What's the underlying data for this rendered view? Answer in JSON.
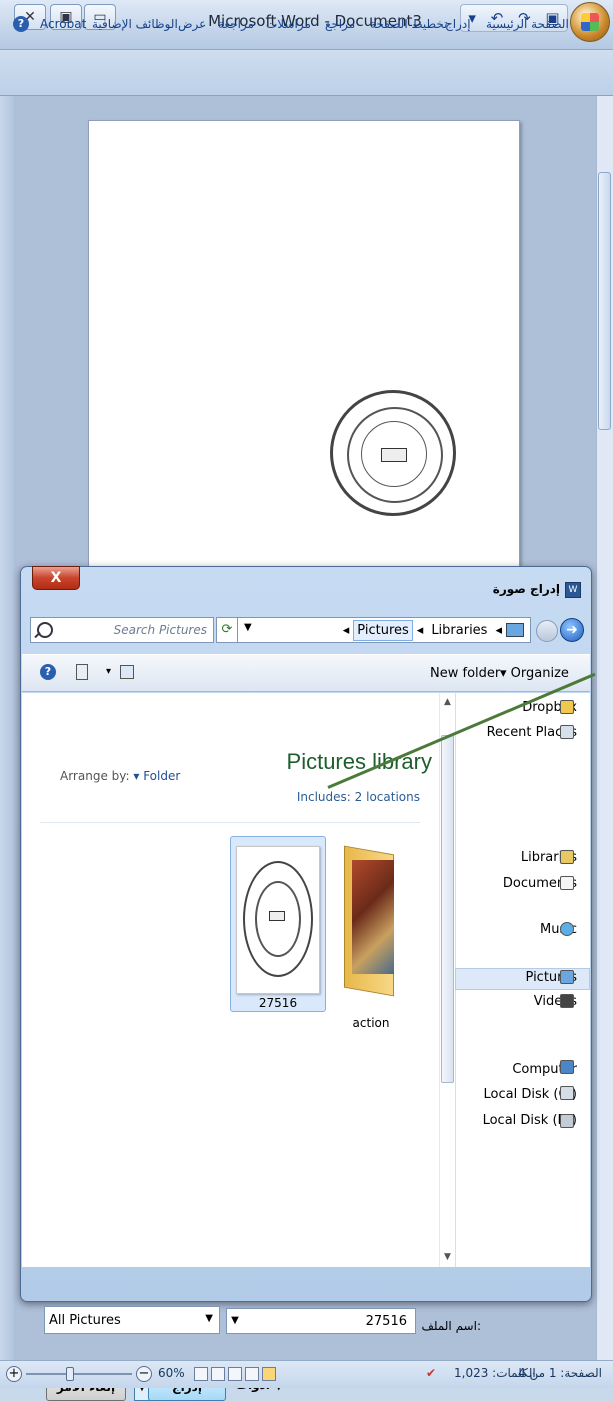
{
  "window": {
    "title": "Microsoft Word - Document3",
    "controls": [
      "close",
      "restore",
      "minimize"
    ]
  },
  "ribbon": {
    "tabs": [
      "الصفحة الرئيسية",
      "إدراج",
      "تخطيط الصفحة",
      "مراجع",
      "مراسلات",
      "مراجعة",
      "عرض",
      "الوظائف الإضافية",
      "Acrobat"
    ]
  },
  "dialog": {
    "title": "إدراج صورة",
    "close": "X",
    "address": [
      "Libraries",
      "Pictures"
    ],
    "search_placeholder": "Search Pictures",
    "toolbar": {
      "organize": "Organize",
      "new_folder": "New folder"
    },
    "library": {
      "title": "Pictures library",
      "includes_label": "Includes:",
      "includes_value": "2 locations",
      "arrange_by_label": "Arrange by:",
      "arrange_by_value": "Folder"
    },
    "nav": {
      "favorites": [
        "Dropbox",
        "Recent Places"
      ],
      "libraries": [
        "Libraries",
        "Documents",
        "Music",
        "Pictures",
        "Videos"
      ],
      "computer": [
        "Computer",
        "Local Disk (C:)",
        "Local Disk (D:)"
      ],
      "selected": "Pictures"
    },
    "files": [
      {
        "name": "27516",
        "type": "image",
        "selected": true
      },
      {
        "name": "action",
        "type": "folder",
        "selected": false
      }
    ],
    "filename_label": "اسم الملف:",
    "filename_value": "27516",
    "filter_value": "All Pictures",
    "tools_label": "أدوات",
    "insert_label": "إدراج",
    "cancel_label": "إلغاء الأمر"
  },
  "status": {
    "page": "الصفحة: 1 من 4",
    "words": "الكلمات: 1,023",
    "zoom": "60%",
    "zoom_level": 0.6
  },
  "colors": {
    "accent": "#15428b",
    "library_title": "#1d5e2c",
    "close_red": "#c8442c"
  }
}
